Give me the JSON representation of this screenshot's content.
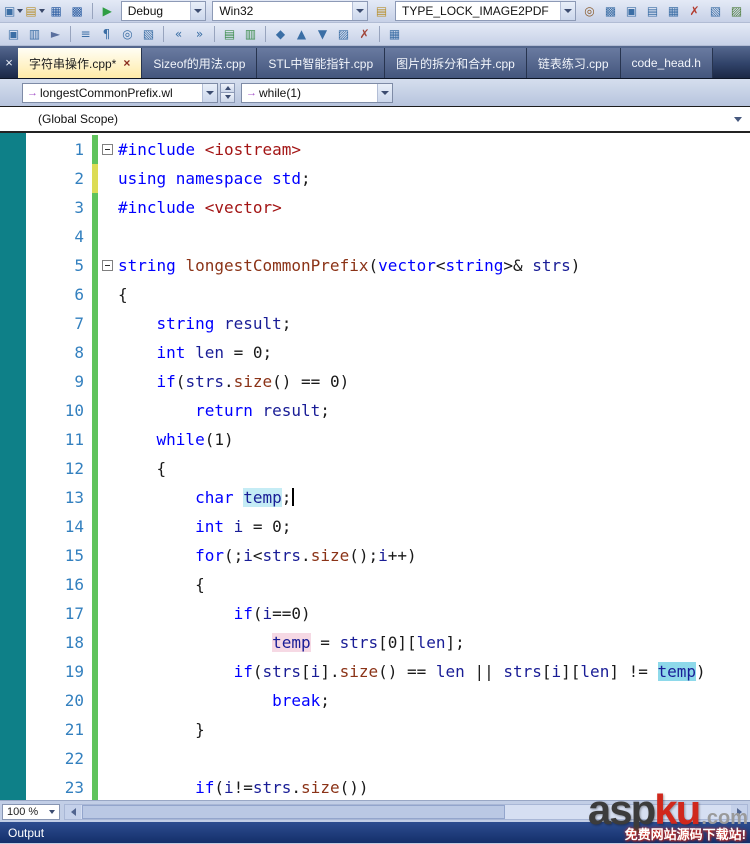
{
  "colors": {
    "keyword": "#0000ff",
    "identifier": "#191d96",
    "function_name": "#8b3317",
    "include_string": "#a31515",
    "line_number": "#3380bf",
    "change_bar_green": "#5fc35c",
    "change_bar_yellow": "#dcdc55",
    "highlight_cyan": "#c5ecf5",
    "highlight_pink": "#f6d9e4",
    "highlight_cyan_strong": "#8ed9ea",
    "editor_margin_teal": "#0e8088",
    "active_tab": "#ffeba8"
  },
  "toolbar_row1": {
    "left_icons": [
      {
        "name": "add-new-item-icon",
        "glyph": "▣",
        "color": "#3b6ea5",
        "caret": true
      },
      {
        "name": "open-file-icon",
        "glyph": "▤",
        "color": "#b8912f",
        "caret": true
      },
      {
        "name": "save-icon",
        "glyph": "▦",
        "color": "#2e5fa3"
      },
      {
        "name": "save-all-icon",
        "glyph": "▩",
        "color": "#2e5fa3"
      },
      {
        "sep": true
      },
      {
        "name": "start-debug-icon",
        "glyph": "▶",
        "color": "#2f9e44"
      }
    ],
    "debug_combo": "Debug",
    "platform_combo": "Win32",
    "mid_icon": {
      "name": "output-log-icon",
      "glyph": "▤",
      "color": "#b8912f"
    },
    "search_combo": "TYPE_LOCK_IMAGE2PDF",
    "right_icons": [
      {
        "name": "find-in-files-icon",
        "glyph": "◎",
        "color": "#8a5a2a"
      },
      {
        "name": "solution-explorer-icon",
        "glyph": "▩",
        "color": "#3b6ea5"
      },
      {
        "name": "team-explorer-icon",
        "glyph": "▣",
        "color": "#3b6ea5"
      },
      {
        "name": "properties-window-icon",
        "glyph": "▤",
        "color": "#3b6ea5"
      },
      {
        "name": "toolbox-icon",
        "glyph": "▦",
        "color": "#3b6ea5"
      },
      {
        "name": "error-list-icon",
        "glyph": "✗",
        "color": "#b23b2e"
      },
      {
        "name": "output-window-icon",
        "glyph": "▧",
        "color": "#3b6ea5"
      },
      {
        "name": "extension-manager-icon",
        "glyph": "▨",
        "color": "#4f7e3f"
      }
    ]
  },
  "toolbar_row2": {
    "icons": [
      {
        "name": "new-window-icon",
        "glyph": "▣",
        "color": "#3b6ea5"
      },
      {
        "name": "split-window-icon",
        "glyph": "▥",
        "color": "#3b6ea5"
      },
      {
        "name": "select-pointer-icon",
        "glyph": "►",
        "color": "#5a6f9e"
      },
      {
        "sep": true
      },
      {
        "name": "member-list-icon",
        "glyph": "≡",
        "color": "#3b6ea5"
      },
      {
        "name": "parameter-info-icon",
        "glyph": "¶",
        "color": "#3b6ea5"
      },
      {
        "name": "quick-info-icon",
        "glyph": "◎",
        "color": "#3b6ea5"
      },
      {
        "name": "word-completion-icon",
        "glyph": "▧",
        "color": "#3b6ea5"
      },
      {
        "sep": true
      },
      {
        "name": "decrease-indent-icon",
        "glyph": "«",
        "color": "#3b6ea5"
      },
      {
        "name": "increase-indent-icon",
        "glyph": "»",
        "color": "#3b6ea5"
      },
      {
        "sep": true
      },
      {
        "name": "comment-icon",
        "glyph": "▤",
        "color": "#3f8e4f"
      },
      {
        "name": "uncomment-icon",
        "glyph": "▥",
        "color": "#3f8e4f"
      },
      {
        "sep": true
      },
      {
        "name": "toggle-bookmark-icon",
        "glyph": "◆",
        "color": "#3b6ea5"
      },
      {
        "name": "prev-bookmark-icon",
        "glyph": "▲",
        "color": "#3b6ea5"
      },
      {
        "name": "next-bookmark-icon",
        "glyph": "▼",
        "color": "#3b6ea5"
      },
      {
        "name": "bookmark-folder-icon",
        "glyph": "▨",
        "color": "#3b6ea5"
      },
      {
        "name": "clear-bookmarks-icon",
        "glyph": "✗",
        "color": "#a04438"
      },
      {
        "sep": true
      },
      {
        "name": "call-hierarchy-icon",
        "glyph": "▦",
        "color": "#3b6ea5"
      }
    ]
  },
  "tab_strip": {
    "close_glyph": "×"
  },
  "tabs": [
    {
      "label": "字符串操作.cpp*",
      "active": true
    },
    {
      "label": "Sizeof的用法.cpp",
      "active": false
    },
    {
      "label": "STL中智能指针.cpp",
      "active": false
    },
    {
      "label": "图片的拆分和合并.cpp",
      "active": false
    },
    {
      "label": "链表练习.cpp",
      "active": false
    },
    {
      "label": "code_head.h",
      "active": false
    }
  ],
  "navbar": {
    "left_combo": {
      "icon_glyph": "→",
      "label": "longestCommonPrefix.wl"
    },
    "right_combo": {
      "icon_glyph": "→",
      "label": "while(1)"
    }
  },
  "scope_bar": {
    "label": "(Global Scope)"
  },
  "editor": {
    "lines": [
      {
        "n": 1,
        "chg": "g",
        "fold": true,
        "tok": [
          [
            "k",
            "#include "
          ],
          [
            "s",
            "<iostream>"
          ]
        ]
      },
      {
        "n": 2,
        "chg": "y",
        "tok": [
          [
            "k",
            "using namespace std"
          ],
          [
            "p",
            ";"
          ]
        ]
      },
      {
        "n": 3,
        "chg": "g",
        "tok": [
          [
            "k",
            "#include "
          ],
          [
            "s",
            "<vector>"
          ]
        ]
      },
      {
        "n": 4,
        "chg": "g",
        "tok": []
      },
      {
        "n": 5,
        "chg": "g",
        "fold": true,
        "tok": [
          [
            "k",
            "string"
          ],
          [
            "p",
            " "
          ],
          [
            "f",
            "longestCommonPrefix"
          ],
          [
            "p",
            "("
          ],
          [
            "k",
            "vector"
          ],
          [
            "p",
            "<"
          ],
          [
            "k",
            "string"
          ],
          [
            "p",
            ">& "
          ],
          [
            "i",
            "strs"
          ],
          [
            "p",
            ")"
          ]
        ]
      },
      {
        "n": 6,
        "chg": "g",
        "tok": [
          [
            "p",
            "{"
          ]
        ]
      },
      {
        "n": 7,
        "chg": "g",
        "tok": [
          [
            "p",
            "    "
          ],
          [
            "k",
            "string"
          ],
          [
            "p",
            " "
          ],
          [
            "i",
            "result"
          ],
          [
            "p",
            ";"
          ]
        ]
      },
      {
        "n": 8,
        "chg": "g",
        "tok": [
          [
            "p",
            "    "
          ],
          [
            "k",
            "int"
          ],
          [
            "p",
            " "
          ],
          [
            "i",
            "len"
          ],
          [
            "p",
            " = 0;"
          ]
        ]
      },
      {
        "n": 9,
        "chg": "g",
        "tok": [
          [
            "p",
            "    "
          ],
          [
            "k",
            "if"
          ],
          [
            "p",
            "("
          ],
          [
            "i",
            "strs"
          ],
          [
            "p",
            "."
          ],
          [
            "f",
            "size"
          ],
          [
            "p",
            "() == 0)"
          ]
        ]
      },
      {
        "n": 10,
        "chg": "g",
        "tok": [
          [
            "p",
            "        "
          ],
          [
            "k",
            "return"
          ],
          [
            "p",
            " "
          ],
          [
            "i",
            "result"
          ],
          [
            "p",
            ";"
          ]
        ]
      },
      {
        "n": 11,
        "chg": "g",
        "tok": [
          [
            "p",
            "    "
          ],
          [
            "k",
            "while"
          ],
          [
            "p",
            "(1)"
          ]
        ]
      },
      {
        "n": 12,
        "chg": "g",
        "tok": [
          [
            "p",
            "    {"
          ]
        ]
      },
      {
        "n": 13,
        "chg": "g",
        "caret": true,
        "tok": [
          [
            "p",
            "        "
          ],
          [
            "k",
            "char"
          ],
          [
            "p",
            " "
          ],
          [
            "hc",
            "temp"
          ],
          [
            "p",
            ";"
          ]
        ]
      },
      {
        "n": 14,
        "chg": "g",
        "tok": [
          [
            "p",
            "        "
          ],
          [
            "k",
            "int"
          ],
          [
            "p",
            " "
          ],
          [
            "i",
            "i"
          ],
          [
            "p",
            " = 0;"
          ]
        ]
      },
      {
        "n": 15,
        "chg": "g",
        "tok": [
          [
            "p",
            "        "
          ],
          [
            "k",
            "for"
          ],
          [
            "p",
            "(;"
          ],
          [
            "i",
            "i"
          ],
          [
            "p",
            "<"
          ],
          [
            "i",
            "strs"
          ],
          [
            "p",
            "."
          ],
          [
            "f",
            "size"
          ],
          [
            "p",
            "();"
          ],
          [
            "i",
            "i"
          ],
          [
            "p",
            "++)"
          ]
        ]
      },
      {
        "n": 16,
        "chg": "g",
        "tok": [
          [
            "p",
            "        {"
          ]
        ]
      },
      {
        "n": 17,
        "chg": "g",
        "tok": [
          [
            "p",
            "            "
          ],
          [
            "k",
            "if"
          ],
          [
            "p",
            "("
          ],
          [
            "i",
            "i"
          ],
          [
            "p",
            "==0)"
          ]
        ]
      },
      {
        "n": 18,
        "chg": "g",
        "tok": [
          [
            "p",
            "                "
          ],
          [
            "hp",
            "temp"
          ],
          [
            "p",
            " = "
          ],
          [
            "i",
            "strs"
          ],
          [
            "p",
            "[0]["
          ],
          [
            "i",
            "len"
          ],
          [
            "p",
            "];"
          ]
        ]
      },
      {
        "n": 19,
        "chg": "g",
        "tok": [
          [
            "p",
            "            "
          ],
          [
            "k",
            "if"
          ],
          [
            "p",
            "("
          ],
          [
            "i",
            "strs"
          ],
          [
            "p",
            "["
          ],
          [
            "i",
            "i"
          ],
          [
            "p",
            "]."
          ],
          [
            "f",
            "size"
          ],
          [
            "p",
            "() == "
          ],
          [
            "i",
            "len"
          ],
          [
            "p",
            " || "
          ],
          [
            "i",
            "strs"
          ],
          [
            "p",
            "["
          ],
          [
            "i",
            "i"
          ],
          [
            "p",
            "]["
          ],
          [
            "i",
            "len"
          ],
          [
            "p",
            "] != "
          ],
          [
            "hk",
            "temp"
          ],
          [
            "p",
            ")"
          ]
        ]
      },
      {
        "n": 20,
        "chg": "g",
        "tok": [
          [
            "p",
            "                "
          ],
          [
            "k",
            "break"
          ],
          [
            "p",
            ";"
          ]
        ]
      },
      {
        "n": 21,
        "chg": "g",
        "tok": [
          [
            "p",
            "        }"
          ]
        ]
      },
      {
        "n": 22,
        "chg": "g",
        "tok": []
      },
      {
        "n": 23,
        "chg": "g",
        "tok": [
          [
            "p",
            "        "
          ],
          [
            "k",
            "if"
          ],
          [
            "p",
            "("
          ],
          [
            "i",
            "i"
          ],
          [
            "p",
            "!="
          ],
          [
            "i",
            "strs"
          ],
          [
            "p",
            "."
          ],
          [
            "f",
            "size"
          ],
          [
            "p",
            "())"
          ]
        ]
      }
    ]
  },
  "bottom": {
    "zoom": "100 %",
    "output": "Output"
  },
  "watermark": {
    "asp": "asp",
    "ku": "ku",
    "com": ".com",
    "tagline": "免费网站源码下载站!"
  }
}
